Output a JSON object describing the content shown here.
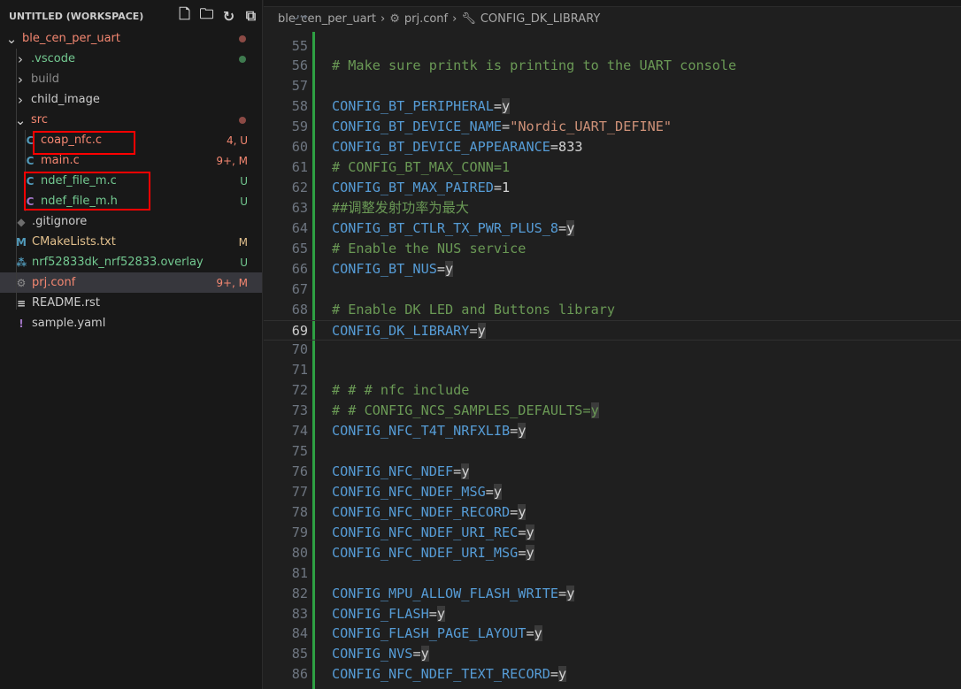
{
  "explorer": {
    "title": "UNTITLED (WORKSPACE)",
    "actions": [
      "new-file-icon",
      "new-folder-icon",
      "refresh-icon",
      "collapse-all-icon"
    ],
    "items": [
      {
        "label": "ble_cen_per_uart",
        "depth": 0,
        "type": "folder-open",
        "color": "#f48771",
        "dot": "#8b4a45"
      },
      {
        "label": ".vscode",
        "depth": 1,
        "type": "folder",
        "color": "#73c991",
        "dot": "#3f7a4f"
      },
      {
        "label": "build",
        "depth": 1,
        "type": "folder",
        "color": "#8c8c8c"
      },
      {
        "label": "child_image",
        "depth": 1,
        "type": "folder",
        "color": "#cccccc"
      },
      {
        "label": "src",
        "depth": 1,
        "type": "folder-open",
        "color": "#f48771",
        "dot": "#8b4a45"
      },
      {
        "label": "coap_nfc.c",
        "depth": 2,
        "type": "c",
        "color": "#f48771",
        "badge": "4, U"
      },
      {
        "label": "main.c",
        "depth": 2,
        "type": "c",
        "color": "#f48771",
        "badge": "9+, M"
      },
      {
        "label": "ndef_file_m.c",
        "depth": 2,
        "type": "c",
        "color": "#73c991",
        "badge": "U"
      },
      {
        "label": "ndef_file_m.h",
        "depth": 2,
        "type": "h",
        "color": "#73c991",
        "badge": "U"
      },
      {
        "label": ".gitignore",
        "depth": 1,
        "type": "git",
        "color": "#cccccc"
      },
      {
        "label": "CMakeLists.txt",
        "depth": 1,
        "type": "cmake",
        "color": "#e2c08d",
        "badge": "M"
      },
      {
        "label": "nrf52833dk_nrf52833.overlay",
        "depth": 1,
        "type": "dts",
        "color": "#73c991",
        "badge": "U"
      },
      {
        "label": "prj.conf",
        "depth": 1,
        "type": "gear",
        "color": "#f48771",
        "badge": "9+, M",
        "selected": true
      },
      {
        "label": "README.rst",
        "depth": 1,
        "type": "text",
        "color": "#cccccc"
      },
      {
        "label": "sample.yaml",
        "depth": 1,
        "type": "yaml",
        "color": "#cccccc"
      }
    ]
  },
  "breadcrumb": [
    "ble_cen_per_uart",
    "prj.conf",
    "CONFIG_DK_LIBRARY"
  ],
  "current_line": 69,
  "lines": [
    {
      "n": "55"
    },
    {
      "n": "56",
      "c": "# Make sure printk is printing to the UART console"
    },
    {
      "n": "57"
    },
    {
      "n": "58",
      "k": "CONFIG_BT_PERIPHERAL",
      "v": "y"
    },
    {
      "n": "59",
      "k": "CONFIG_BT_DEVICE_NAME",
      "s": "\"Nordic_UART_DEFINE\""
    },
    {
      "n": "60",
      "k": "CONFIG_BT_DEVICE_APPEARANCE",
      "num": "833"
    },
    {
      "n": "61",
      "c": "# CONFIG_BT_MAX_CONN=1"
    },
    {
      "n": "62",
      "k": "CONFIG_BT_MAX_PAIRED",
      "num": "1"
    },
    {
      "n": "63",
      "c": "##调整发射功率为最大"
    },
    {
      "n": "64",
      "k": "CONFIG_BT_CTLR_TX_PWR_PLUS_8",
      "v": "y"
    },
    {
      "n": "65",
      "c": "# Enable the NUS service"
    },
    {
      "n": "66",
      "k": "CONFIG_BT_NUS",
      "v": "y"
    },
    {
      "n": "67"
    },
    {
      "n": "68",
      "c": "# Enable DK LED and Buttons library"
    },
    {
      "n": "69",
      "k": "CONFIG_DK_LIBRARY",
      "v": "y"
    },
    {
      "n": "70"
    },
    {
      "n": "71"
    },
    {
      "n": "72",
      "c": "# # # nfc include"
    },
    {
      "n": "73",
      "c": "# # CONFIG_NCS_SAMPLES_DEFAULTS=",
      "cv": "y"
    },
    {
      "n": "74",
      "k": "CONFIG_NFC_T4T_NRFXLIB",
      "v": "y"
    },
    {
      "n": "75"
    },
    {
      "n": "76",
      "k": "CONFIG_NFC_NDEF",
      "v": "y"
    },
    {
      "n": "77",
      "k": "CONFIG_NFC_NDEF_MSG",
      "v": "y"
    },
    {
      "n": "78",
      "k": "CONFIG_NFC_NDEF_RECORD",
      "v": "y"
    },
    {
      "n": "79",
      "k": "CONFIG_NFC_NDEF_URI_REC",
      "v": "y"
    },
    {
      "n": "80",
      "k": "CONFIG_NFC_NDEF_URI_MSG",
      "v": "y"
    },
    {
      "n": "81"
    },
    {
      "n": "82",
      "k": "CONFIG_MPU_ALLOW_FLASH_WRITE",
      "v": "y"
    },
    {
      "n": "83",
      "k": "CONFIG_FLASH",
      "v": "y"
    },
    {
      "n": "84",
      "k": "CONFIG_FLASH_PAGE_LAYOUT",
      "v": "y"
    },
    {
      "n": "85",
      "k": "CONFIG_NVS",
      "v": "y"
    },
    {
      "n": "86",
      "k": "CONFIG_NFC_NDEF_TEXT_RECORD",
      "v": "y"
    }
  ]
}
